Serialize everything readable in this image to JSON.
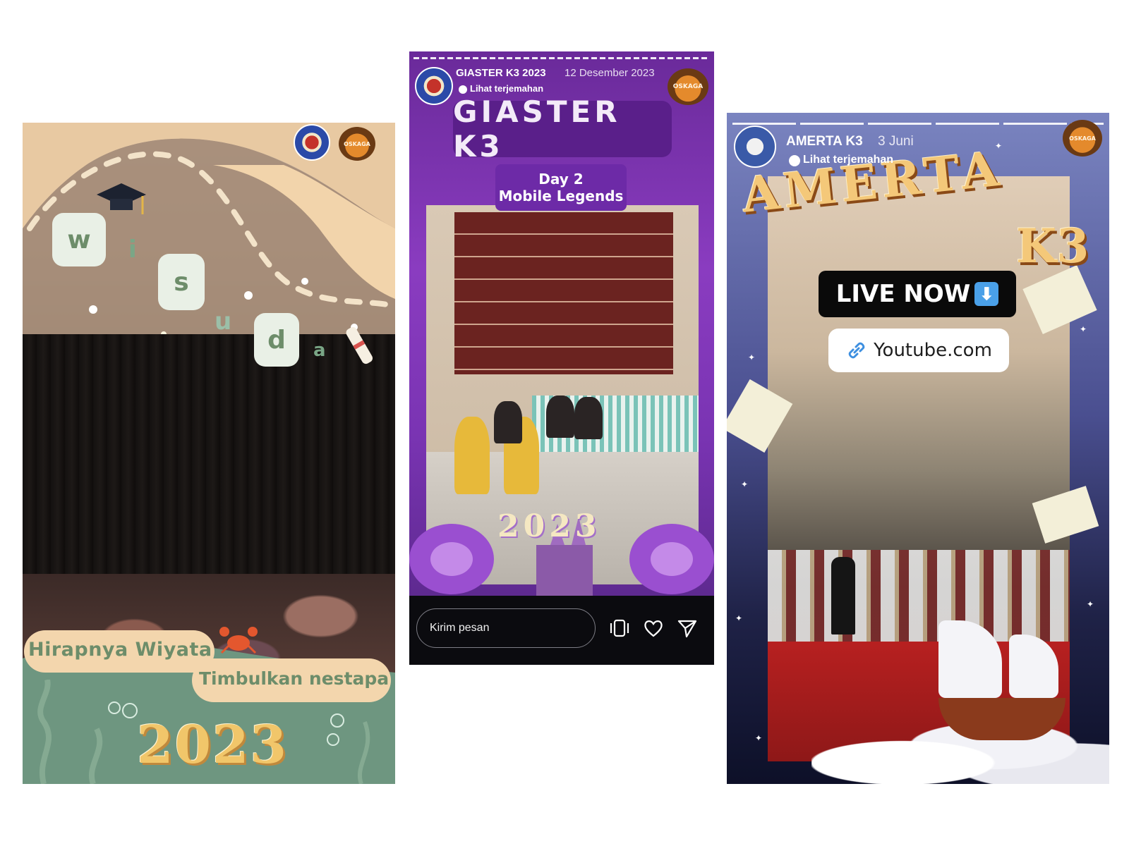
{
  "story1": {
    "letters": [
      "w",
      "i",
      "s",
      "u",
      "d",
      "a"
    ],
    "caption_line1": "Hirapnya Wiyata",
    "caption_line2": "Timbulkan nestapa",
    "year": "2023",
    "logo_right": "OSKAGA"
  },
  "story2": {
    "username": "GIASTER K3 2023",
    "date": "12 Desember 2023",
    "translate": "Lihat terjemahan",
    "title": "GIASTER K3",
    "day": "Day 2",
    "game": "Mobile Legends",
    "year": "2023",
    "logo_right": "OSKAGA",
    "message_placeholder": "Kirim pesan",
    "icons": [
      "repost-icon",
      "heart-icon",
      "send-icon"
    ]
  },
  "story3": {
    "username": "AMERTA K3",
    "date": "3 Juni",
    "translate": "Lihat terjemahan",
    "title": "AMERTA",
    "title_suffix": "K3",
    "live_label": "LIVE NOW",
    "live_icon": "⬇",
    "link_label": "Youtube.com",
    "logo_right": "OSKAGA"
  },
  "colors": {
    "wisuda_green": "#6d8d6a",
    "giaster_purple": "#8a3cc0",
    "amerta_gold": "#f4c879",
    "live_blue": "#4aa0e8"
  }
}
